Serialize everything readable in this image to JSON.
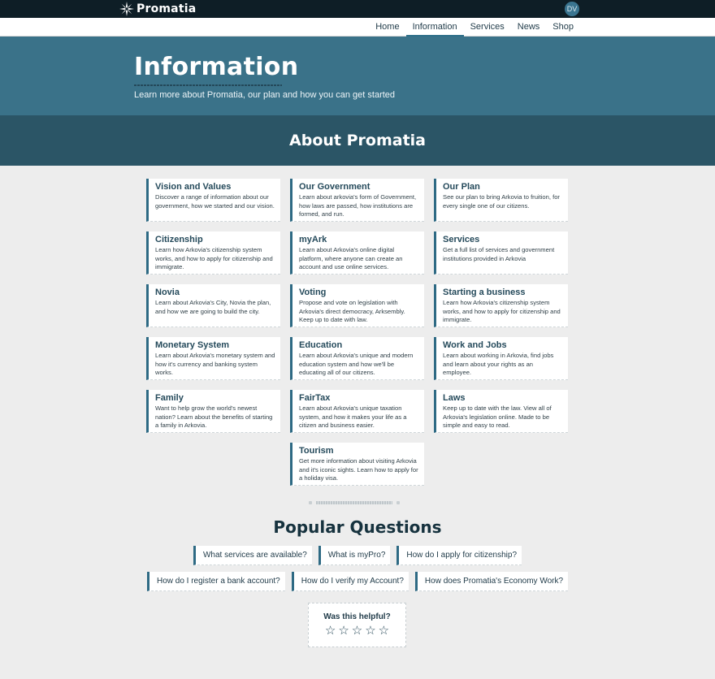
{
  "app": {
    "name": "Promatia"
  },
  "user": {
    "initials": "DV"
  },
  "nav": [
    "Home",
    "Information",
    "Services",
    "News",
    "Shop"
  ],
  "nav_active": "Information",
  "hero": {
    "title": "Information",
    "subtitle": "Learn more about Promatia, our plan and how you can get started"
  },
  "section": {
    "title": "About Promatia"
  },
  "cards": [
    {
      "title": "Vision and Values",
      "desc": "Discover a range of information about our government, how we started and our vision."
    },
    {
      "title": "Our Government",
      "desc": "Learn about arkovia's form of Government, how laws are passed, how institutions are formed, and run."
    },
    {
      "title": "Our Plan",
      "desc": "See our plan to bring Arkovia to fruition, for every single one of our citizens."
    },
    {
      "title": "Citizenship",
      "desc": "Learn how Arkovia's citizenship system works, and how to apply for citizenship and immigrate."
    },
    {
      "title": "myArk",
      "desc": "Learn about Arkovia's online digital platform, where anyone can create an account and use online services."
    },
    {
      "title": "Services",
      "desc": "Get a full list of services and government institutions provided in Arkovia"
    },
    {
      "title": "Novia",
      "desc": "Learn about Arkovia's City, Novia the plan, and how we are going to build the city."
    },
    {
      "title": "Voting",
      "desc": "Propose and vote on legislation with Arkovia's direct democracy, Arksembly. Keep up to date with law."
    },
    {
      "title": "Starting a business",
      "desc": "Learn how Arkovia's citizenship system works, and how to apply for citizenship and immigrate."
    },
    {
      "title": "Monetary System",
      "desc": "Learn about Arkovia's monetary system and how it's currency and banking system works."
    },
    {
      "title": "Education",
      "desc": "Learn about Arkovia's unique and modern education system and how we'll be educating all of our citizens."
    },
    {
      "title": "Work and Jobs",
      "desc": "Learn about working in Arkovia, find jobs and learn about your rights as an employee."
    },
    {
      "title": "Family",
      "desc": "Want to help grow the world's newest nation? Learn about the benefits of starting a family in Arkovia."
    },
    {
      "title": "FairTax",
      "desc": "Learn about Arkovia's unique taxation system, and how it makes your life as a citizen and business easier."
    },
    {
      "title": "Laws",
      "desc": "Keep up to date with the law. View all of Arkovia's legislation online. Made to be simple and easy to read."
    },
    {
      "title": "Tourism",
      "desc": "Get more information about visiting Arkovia and it's iconic sights. Learn how to apply for a holiday visa."
    }
  ],
  "popular": {
    "title": "Popular Questions",
    "row1": [
      "What services are available?",
      "What is myPro?",
      "How do I apply for citizenship?"
    ],
    "row2": [
      "How do I register a bank account?",
      "How do I verify my Account?",
      "How does Promatia's Economy Work?"
    ]
  },
  "feedback": {
    "label": "Was this helpful?",
    "stars": 5,
    "rating": 0
  },
  "icons": {
    "logo": "star-burst-icon",
    "rating": "star-outline-icon"
  },
  "colors": {
    "topbar": "#0e1e26",
    "hero": "#3a7289",
    "band": "#2b5566",
    "accent": "#2e6a84"
  }
}
